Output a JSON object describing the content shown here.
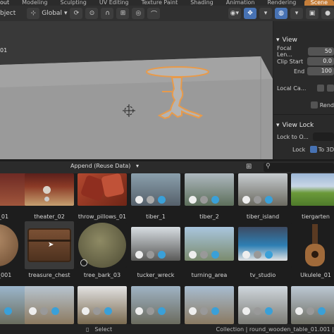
{
  "topbar": {
    "tabs": [
      "out",
      "Modeling",
      "Sculpting",
      "UV Editing",
      "Texture Paint",
      "Shading",
      "Animation",
      "Rendering"
    ],
    "active_tab": "Scene"
  },
  "toolbar": {
    "mode_label": "bject",
    "orientation_label": "Global",
    "orientation_caret": "▾"
  },
  "viewport": {
    "object_label": "01"
  },
  "npanel": {
    "view_header": "View",
    "rows": [
      {
        "label": "Focal Len...",
        "value": "50"
      },
      {
        "label": "Clip Start",
        "value": "0.0"
      },
      {
        "label": "End",
        "value": "100"
      }
    ],
    "local_camera_label": "Local Ca...",
    "render_label": "Rend",
    "view_lock_header": "View Lock",
    "lock_to_object_label": "Lock to O...",
    "lock_label": "Lock",
    "lock_to3d_label": "To 3D"
  },
  "asset_browser": {
    "append_label": "Append (Reuse Data)",
    "append_caret": "▾",
    "row1": [
      "_01",
      "theater_02",
      "throw_pillows_01",
      "tiber_1",
      "tiber_2",
      "tiber_island",
      "tiergarten"
    ],
    "row2": [
      "r_001",
      "treasure_chest",
      "tree_bark_03",
      "tucker_wreck",
      "turning_area",
      "tv_studio",
      "Ukulele_01"
    ]
  },
  "status": {
    "select_label": "Select",
    "collection_label": "Collection | round_wooden_table_01.001 | "
  },
  "colors": {
    "accent_blue": "#4772b3",
    "active_orange": "#c57e3a",
    "selection_outline": "#e89a4a"
  }
}
